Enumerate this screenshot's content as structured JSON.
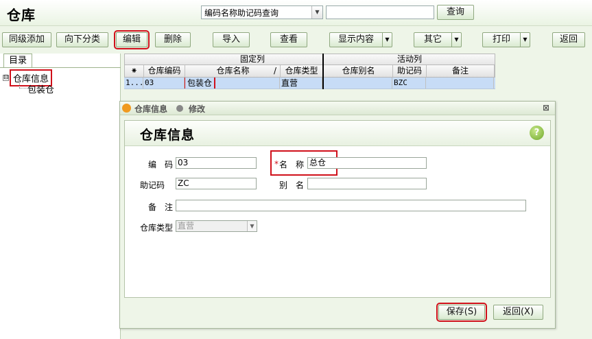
{
  "page": {
    "title": "仓库"
  },
  "search": {
    "selected_mode": "编码名称助记码查询",
    "input_value": "",
    "query_label": "查询"
  },
  "toolbar": {
    "add_sibling": "同级添加",
    "add_child": "向下分类",
    "edit": "编辑",
    "delete": "删除",
    "import": "导入",
    "view": "查看",
    "display_content": "显示内容",
    "other": "其它",
    "print": "打印",
    "back": "返回"
  },
  "sidebar": {
    "tab": "目录",
    "root": {
      "toggle": "⊟",
      "label": "仓库信息"
    },
    "children": [
      {
        "label": "包装仓"
      }
    ]
  },
  "grid": {
    "groups": [
      "固定列",
      "活动列"
    ],
    "columns": [
      "⁕",
      "仓库编码",
      "仓库名称",
      "/",
      "仓库类型",
      "仓库别名",
      "助记码",
      "备注"
    ],
    "rows": [
      {
        "index": "1...",
        "code": "03",
        "name": "包装仓",
        "type": "直营",
        "alias": "",
        "mnemonic": "BZC",
        "note": ""
      }
    ]
  },
  "dialog": {
    "title": "仓库信息",
    "mode": "修改",
    "close": "⊠",
    "form_title": "仓库信息",
    "help": "?",
    "fields": {
      "code_label": "编　码",
      "code_value": "03",
      "name_required": "*",
      "name_label": "名　称",
      "name_value": "总仓",
      "mnemonic_label": "助记码",
      "mnemonic_value": "ZC",
      "alias_label": "别　名",
      "alias_value": "",
      "note_label": "备　注",
      "note_value": "",
      "type_label": "仓库类型",
      "type_value": "直营"
    },
    "save": "保存(S)",
    "back": "返回(X)"
  },
  "colors": {
    "highlight": "#d0101a",
    "selected_row": "#c7dcf6",
    "toolbar_bg": "#eef5e8"
  }
}
